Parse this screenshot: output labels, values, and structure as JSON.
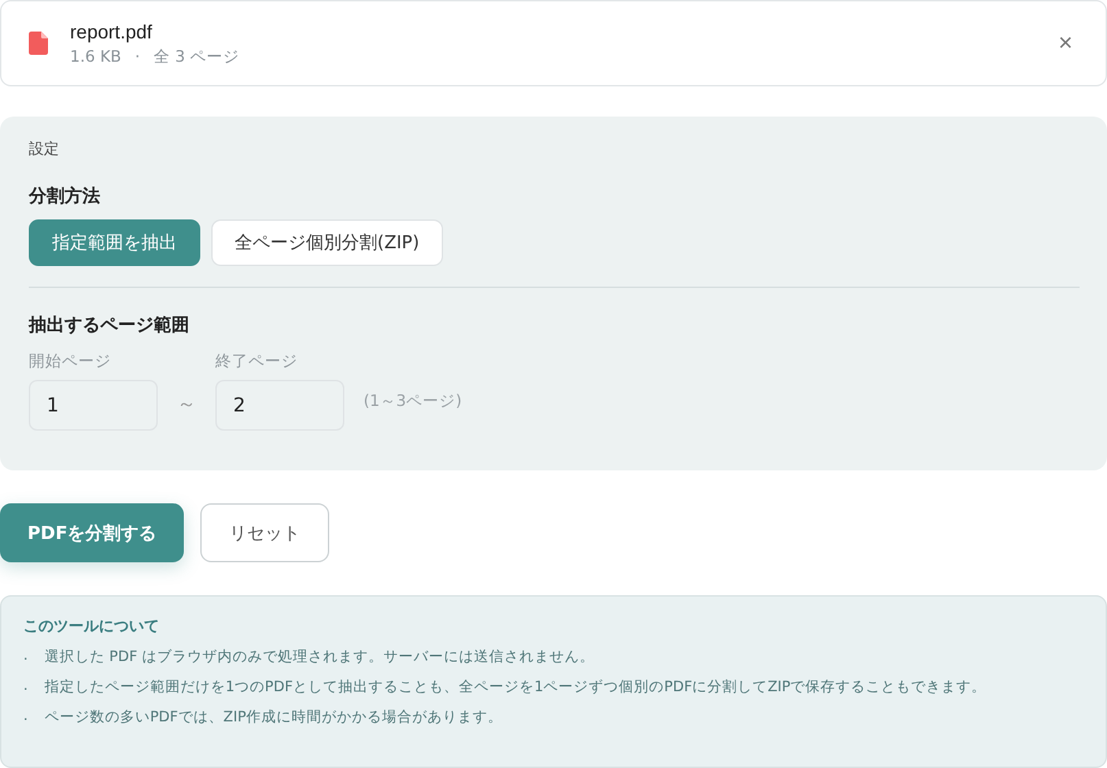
{
  "file": {
    "name": "report.pdf",
    "size": "1.6 KB",
    "separator": "·",
    "pages": "全 3 ページ",
    "close": "×"
  },
  "settings": {
    "title": "設定",
    "method_label": "分割方法",
    "methods": [
      {
        "label": "指定範囲を抽出",
        "selected": true
      },
      {
        "label": "全ページ個別分割(ZIP)",
        "selected": false
      }
    ],
    "range_label": "抽出するページ範囲",
    "start": {
      "label": "開始ページ",
      "value": "1"
    },
    "tilde": "～",
    "end": {
      "label": "終了ページ",
      "value": "2"
    },
    "hint": "(1～3ページ)"
  },
  "actions": [
    {
      "label": "PDFを分割する",
      "kind": "primary"
    },
    {
      "label": "リセット",
      "kind": "secondary"
    }
  ],
  "about": {
    "title": "このツールについて",
    "items": [
      {
        "marker": ".",
        "text": "選択した PDF はブラウザ内のみで処理されます。サーバーには送信されません。"
      },
      {
        "marker": ".",
        "text": "指定したページ範囲だけを1つのPDFとして抽出することも、全ページを1ページずつ個別のPDFに分割してZIPで保存することもできます。"
      },
      {
        "marker": ".",
        "text": "ページ数の多いPDFでは、ZIP作成に時間がかかる場合があります。"
      }
    ]
  }
}
